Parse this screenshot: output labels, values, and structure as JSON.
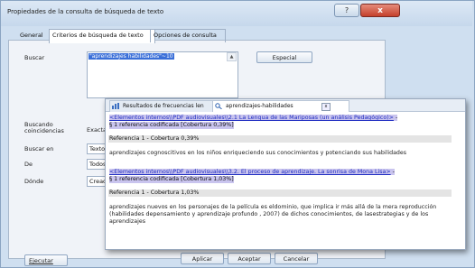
{
  "window": {
    "title": "Propiedades de la consulta de búsqueda de texto",
    "help_label": "?",
    "close_label": "x"
  },
  "tabs": [
    {
      "label": "General",
      "selected": false
    },
    {
      "label": "Criterios de búsqueda de texto",
      "selected": true
    },
    {
      "label": "Opciones de consulta",
      "selected": false
    }
  ],
  "form": {
    "buscar_label": "Buscar",
    "search_value": "\"aprendizajes habilidades\"~10",
    "especial_label": "Especial",
    "buscando_label": "Buscando coincidencias",
    "buscando_value": "Exacta",
    "buscar_en_label": "Buscar en",
    "buscar_en_value": "Texto",
    "de_label": "De",
    "de_value": "Todos",
    "donde_label": "Dónde",
    "donde_value": "Creada"
  },
  "footer": {
    "ejecutar_label": "Ejecutar",
    "aplicar_label": "Aplicar",
    "aceptar_label": "Aceptar",
    "cancelar_label": "Cancelar"
  },
  "results": {
    "tabs": [
      {
        "label": "Resultados de frecuencias len",
        "icon": "chart-icon"
      },
      {
        "label": "aprendizajes-habilidades",
        "icon": "search-icon"
      }
    ],
    "entries": [
      {
        "link": "<Elementos internos\\\\PDF audiovisuales\\\\2.1 La Lengua de las Mariposas (un análisis Pedagógico)>",
        "link_suffix": " -",
        "summary": "§ 1 referencia codificada  [Cobertura 0,39%]",
        "reference": "Referencia 1 - Cobertura 0,39%",
        "text": "aprendizajes cognoscitivos en los niños enriqueciendo sus conocimientos y potenciando sus habilidades"
      },
      {
        "link": "<Elementos internos\\\\PDF audiovisuales\\\\3.2. El proceso de aprendizaje. La sonrisa de Mona Lisa>",
        "link_suffix": " -",
        "summary": "§ 1 referencia codificada  [Cobertura 1,03%]",
        "reference": "Referencia 1 - Cobertura 1,03%",
        "text": "aprendizajes nuevos en los personajes de la película es eldominio, que implica ir más allá de la mera reproducción (habilidades depensamiento y aprendizaje profundo , 2007) de dichos conocimientos, de lasestrategias y de los aprendizajes"
      }
    ]
  },
  "colors": {
    "link": "#1f2dc2",
    "highlight": "#c9c4ee",
    "selection": "#3a6fd8",
    "close_button": "#c4402b"
  }
}
